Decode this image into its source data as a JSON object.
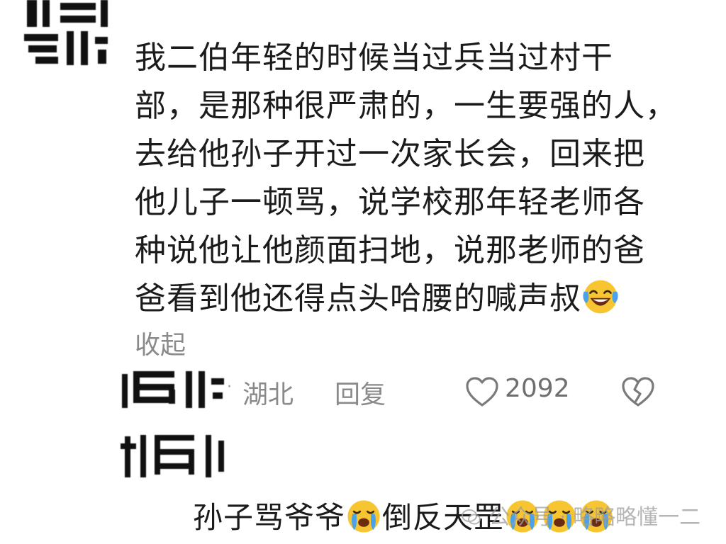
{
  "comment": {
    "lines": [
      "我二伯年轻的时候当过兵当过村干",
      "部，是那种很严肃的，一生要强的人，",
      "去给他孙子开过一次家长会，回来把",
      "他儿子一顿骂，说学校那年轻老师各",
      "种说他让他颜面扫地，说那老师的爸",
      "爸看到他还得点头哈腰的喊声叔"
    ],
    "trailing_emoji": "laughing-crying-emoji",
    "collapse_label": "收起",
    "location": "湖北",
    "reply_label": "回复",
    "like_count": "2092"
  },
  "reply": {
    "text_before": "孙子骂爷爷",
    "text_after": "倒反天罡",
    "emoji": "crying-emoji"
  },
  "watermark": {
    "text": "公众号 · 略略略懂一二"
  },
  "colors": {
    "text": "#1b1b1b",
    "meta": "#8a8a8a",
    "emoji_yellow": "#f7c531",
    "emoji_blue": "#4aa3e8"
  }
}
